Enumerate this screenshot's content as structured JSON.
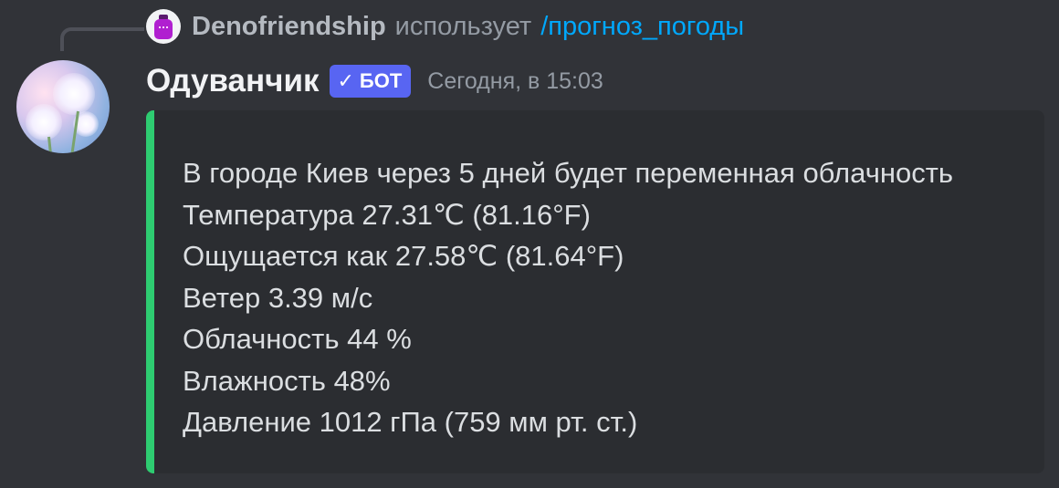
{
  "reply": {
    "username": "Denofriendship",
    "uses_text": "использует",
    "command": "/прогноз_погоды"
  },
  "message": {
    "author": "Одуванчик",
    "bot_tag": "БОТ",
    "timestamp": "Сегодня, в 15:03"
  },
  "embed": {
    "accent_color": "#2ecc71",
    "lines": [
      "В городе Киев через 5 дней будет переменная облачность",
      "Температура 27.31℃ (81.16°F)",
      "Ощущается как 27.58℃ (81.64°F)",
      "Ветер 3.39 м/с",
      "Облачность 44 %",
      "Влажность 48%",
      "Давление 1012 гПа (759 мм рт. ст.)"
    ]
  },
  "colors": {
    "background": "#313338",
    "embed_background": "#2b2d31",
    "bot_tag": "#5865f2",
    "command_link": "#00a8fc"
  },
  "icons": {
    "bot_tag_icon": "check-icon",
    "reply_avatar": "potion-jar-avatar",
    "author_avatar": "dandelion-avatar"
  }
}
